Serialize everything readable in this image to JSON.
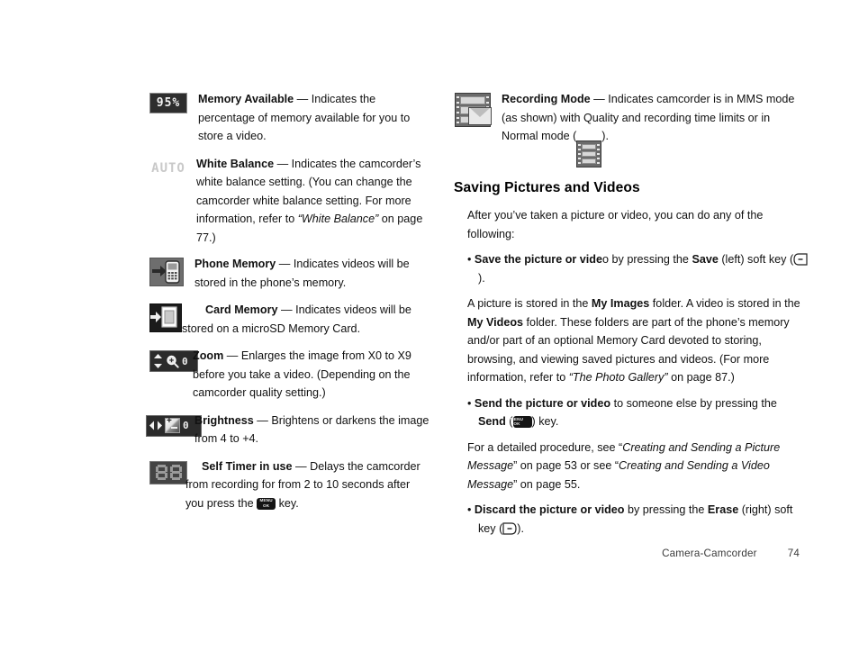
{
  "document": {
    "footer": {
      "section": "Camera-Camcorder",
      "page": "74"
    }
  },
  "left_column": {
    "entries": [
      {
        "icon": "memory-available-icon",
        "icon_text": "95%",
        "term": "Memory Available",
        "dash": " — ",
        "body": "Indicates the percentage of memory available for you to store a video."
      },
      {
        "icon": "white-balance-auto-icon",
        "icon_text": "AUTO",
        "term": "White Balance",
        "dash": " — ",
        "body_part1": "Indicates the camcorder’s white balance setting. (You can change the camcorder white balance setting. For more information, refer to ",
        "body_italic": "“White Balance”",
        "body_part2": " on page 77.)"
      },
      {
        "icon": "phone-memory-icon",
        "term": "Phone Memory",
        "dash": " — ",
        "body": "Indicates videos will be stored in the phone’s memory."
      },
      {
        "icon": "card-memory-icon",
        "term": "Card Memory",
        "dash": " — ",
        "body": "Indicates videos will be stored on a microSD Memory Card."
      },
      {
        "icon": "zoom-icon",
        "icon_value": "0",
        "term": "Zoom",
        "dash": " — ",
        "body": "Enlarges the image from X0 to X9 before you take a video. (Depending on the camcorder quality setting.)"
      },
      {
        "icon": "brightness-icon",
        "icon_value": "0",
        "term": "Brightness",
        "dash": " — ",
        "body": "Brightens or darkens the image from 4 to +4."
      },
      {
        "icon": "self-timer-icon",
        "term": "Self Timer in use",
        "dash": " — ",
        "body_part1": "Delays the camcorder from recording for from 2 to 10 seconds after you press the ",
        "key_glyph": "menu-ok-key",
        "key_line1": "MENU",
        "key_line2": "OK",
        "body_part2": " key."
      }
    ]
  },
  "right_column": {
    "recording_mode": {
      "icon": "recording-mode-mms-icon",
      "term": "Recording Mode",
      "dash": " — ",
      "body_part1": "Indicates camcorder is in MMS mode (as shown) with Quality and recording time limits or in Normal mode (",
      "inline_icon": "normal-mode-film-icon",
      "body_part2": ")."
    },
    "section_heading": "Saving Pictures and Videos",
    "intro": "After you’ve taken a picture or video, you can do any of the following:",
    "bullets": [
      {
        "marker": "• ",
        "bold_lead": "Save the picture or vide",
        "text1": "o by pressing the ",
        "bold_mid": "Save",
        "text2": " (left) soft key (",
        "key_glyph": "left-soft-key",
        "text3": ")."
      },
      {
        "marker": "• ",
        "bold_lead": "Send the picture or video",
        "text1": " to someone else by pressing the ",
        "bold_mid": "Send",
        "text2": " (",
        "key_glyph": "menu-ok-key",
        "key_line1": "MENU",
        "key_line2": "OK",
        "text3": ") key."
      },
      {
        "marker": "• ",
        "bold_lead": "Discard the picture or video",
        "text1": " by pressing the ",
        "bold_mid": "Erase",
        "text2": " (right) soft key (",
        "key_glyph": "right-soft-key",
        "text3": ")."
      }
    ],
    "paragraph_storage": {
      "p1": "A picture is stored in the ",
      "b1": "My Images",
      "p2": " folder. A video is stored in the ",
      "b2": "My Videos",
      "p3": " folder. These folders are part of the phone’s memory and/or part of an optional Memory Card devoted to storing, browsing, and viewing saved pictures and videos. (For more information, refer to ",
      "i1": "“The Photo Gallery”",
      "p4": " on page 87.)"
    },
    "paragraph_procedure": {
      "p1": "For a detailed procedure, see “",
      "i1": "Creating and Sending a Picture Message",
      "p2": "” on page 53 or see “",
      "i2": "Creating and Sending a Video Message",
      "p3": "” on page 55."
    }
  }
}
